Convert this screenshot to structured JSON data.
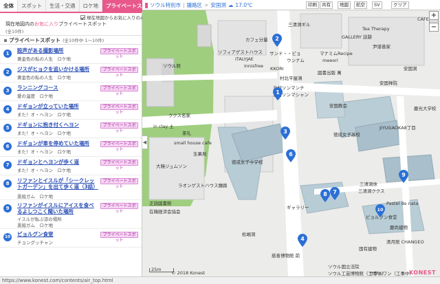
{
  "sidebar": {
    "tabs": [
      "全体",
      "スポット",
      "生活・交通",
      "ロケ地",
      "プライベートスポット"
    ],
    "filter_label": "現在地図からお気に入りのみを表示",
    "info_prefix": "現在地図内の",
    "info_highlight": "お気に入り",
    "info_suffix": "プライベートスポット",
    "info_count": "(全10件)",
    "section_title": "プライベートスポット",
    "section_count": "(全10件中 1〜10件)",
    "items": [
      {
        "num": "1",
        "title": "殴声がある撮影場所",
        "sub": "黄金色の私の人生　ロケ地",
        "badge": "プライベートスポット"
      },
      {
        "num": "2",
        "title": "ジスがヒョクを追いかける場所",
        "sub": "黄金色の私の人生　ロケ地",
        "badge": "プライベートスポット"
      },
      {
        "num": "3",
        "title": "ランニングコース",
        "sub": "愛の温度　ロケ地",
        "badge": "プライベートスポット"
      },
      {
        "num": "4",
        "title": "ドギョンが立っていた場所",
        "sub": "また！オ・ヘヨン　ロケ地",
        "badge": "プライベートスポット"
      },
      {
        "num": "5",
        "title": "ドギョンに抱き付くヘヨン",
        "sub": "また！オ・ヘヨン　ロケ地",
        "badge": "プライベートスポット"
      },
      {
        "num": "6",
        "title": "ドギョンが車を停めていた場所",
        "sub": "また！オ・ヘヨン　ロケ地",
        "badge": "プライベートスポット"
      },
      {
        "num": "7",
        "title": "ドギョンとヘヨンが歩く道",
        "sub": "また！オ・ヘヨン　ロケ地",
        "badge": "プライベートスポット"
      },
      {
        "num": "8",
        "title": "リファンとイスルが「シークレットガーデン」を出て歩く道（3話）",
        "sub": "黒船ガム　ロケ地",
        "badge": "プライベートスポット"
      },
      {
        "num": "9",
        "title": "リファンがイスルにアイスを食べるよしつこく聞いた場所",
        "sub": "イスルが私ぶ涼の場所",
        "sub2": "黒船ガム　ロケ地",
        "badge": "プライベートスポット"
      },
      {
        "num": "10",
        "title": "ピョルグン食堂",
        "sub": "チョングッチャン",
        "badge": "プライベートスポット"
      }
    ]
  },
  "toolbar": {
    "city": "ソウル特別市",
    "district": "鍾路区",
    "area": "安国洞",
    "weather": "17.0℃",
    "buttons": [
      "印刷",
      "共有",
      "地図",
      "航空",
      "SV",
      "クリア"
    ]
  },
  "map": {
    "labels": [
      "カフェ分量",
      "三清洞ギル",
      "GALLERY 誌跡",
      "Tea Therapy",
      "CAFE",
      "ソウル館",
      "ソフィアゲストハウス",
      "ITALYJAE",
      "innisfree",
      "サンド・・ビョ",
      "ウンナム",
      "KKORI",
      "村北平屋鴻",
      "マナミムRecipe",
      "meeori",
      "尹谱善家",
      "図書出版 萬",
      "安国禅院",
      "徳成女子中学校",
      "徳成女子高校",
      "安国教会",
      "安国洞",
      "JIYUGAOKA8丁目",
      "三清洞ククス",
      "ピョルグン食堂",
      "慶尚建物",
      "国有建物",
      "松峴洞",
      "正読図書館",
      "ラオンゲストハウス鍾路",
      "small house cafe",
      "in clay 土",
      "茶礼",
      "ククス名家",
      "生果局",
      "Pastel de nata",
      "北村ソンマンチ",
      "ソウル国立法院",
      "在韓経済会協会",
      "清月館 CHANGEO",
      "北村ソンマシャン",
      "サプルワン（工事中）",
      "ギャラリー",
      "ソウル工芸博物館（工事中）",
      "慈善博物館 前",
      "大韓ジュムソン",
      "三清洞休",
      "慶光大学校"
    ],
    "markers": [
      "1",
      "2",
      "3",
      "4",
      "5",
      "6",
      "7",
      "8",
      "9",
      "10"
    ],
    "scale": "25m",
    "copyright": "© 2018 Konest",
    "brand": "KONEST"
  },
  "statusbar": {
    "url": "https://www.konest.com/contents/air_top.html"
  },
  "colors": {
    "accent": "#e8588b",
    "marker": "#2b6fd6",
    "badge_bg": "#f6d3f3"
  }
}
